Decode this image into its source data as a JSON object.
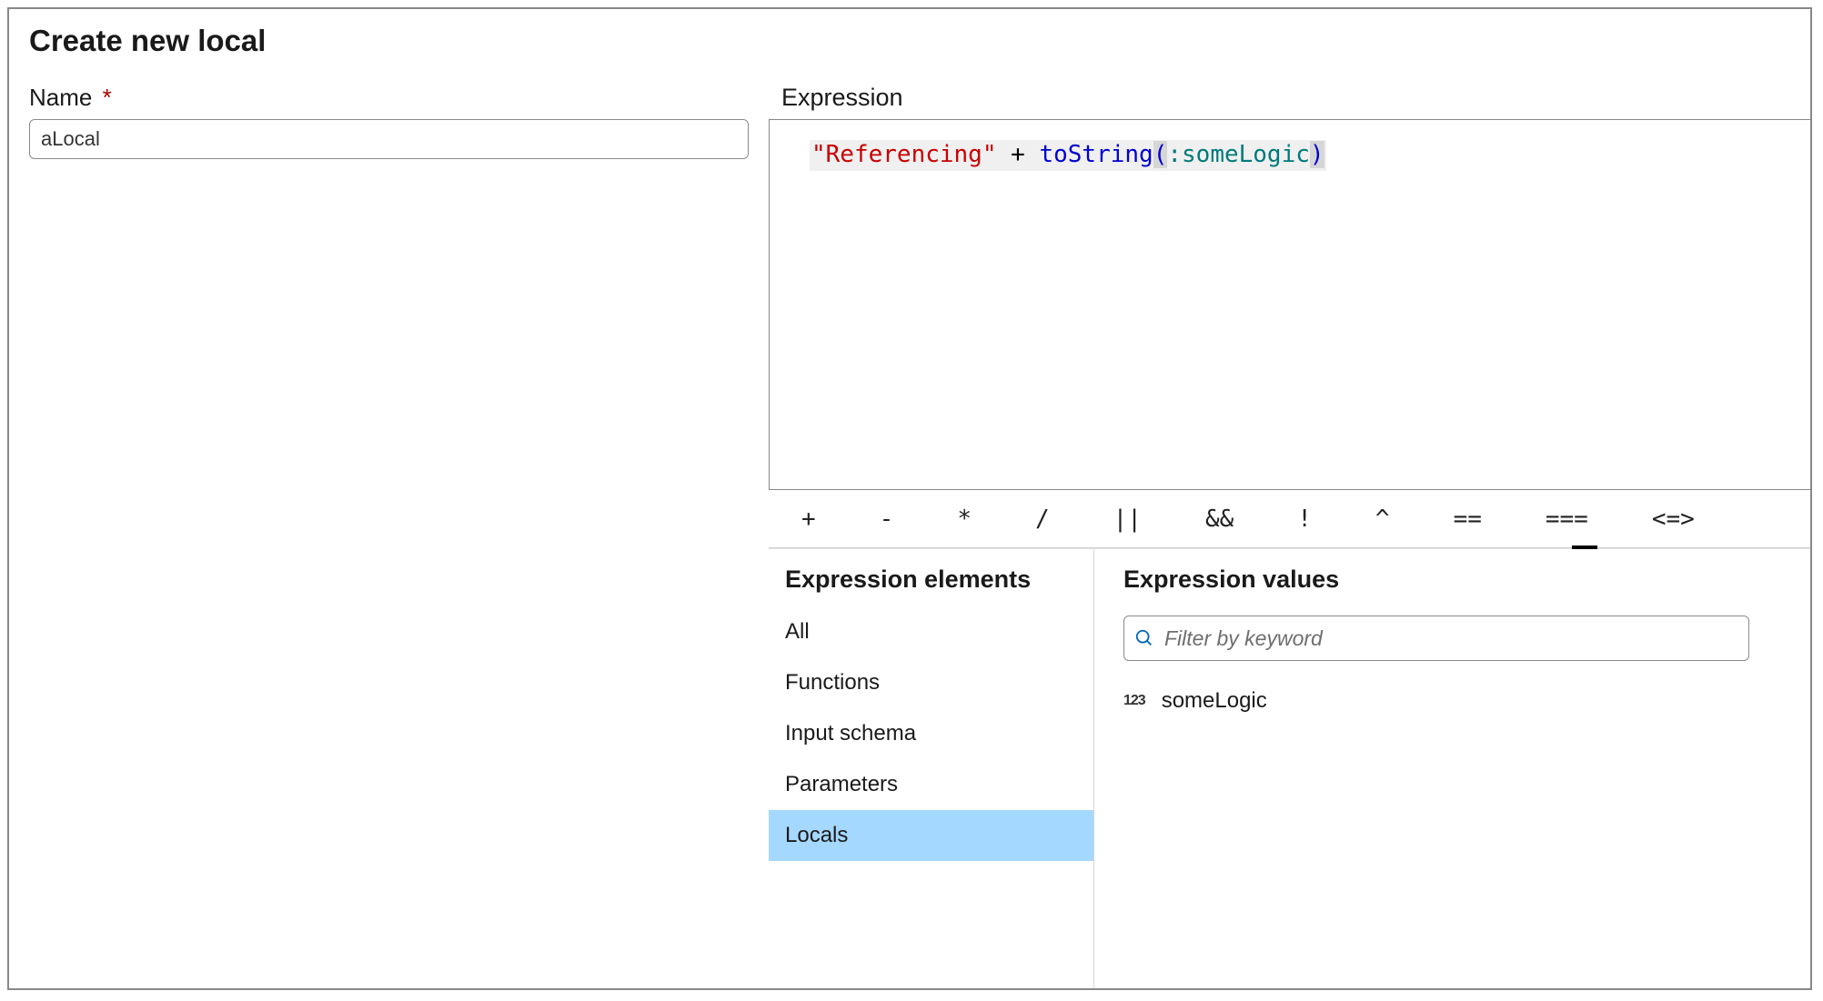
{
  "header": {
    "title": "Create new local"
  },
  "form": {
    "name_label": "Name",
    "required_marker": "*",
    "name_value": "aLocal"
  },
  "expression": {
    "label": "Expression",
    "tokens": {
      "string": "\"Referencing\"",
      "space1": " ",
      "plus": "+",
      "space2": " ",
      "fn": "toString",
      "open": "(",
      "colon": ":",
      "ident": "someLogic",
      "close": ")"
    },
    "raw": "\"Referencing\" + toString(:someLogic)"
  },
  "operators": {
    "items": [
      "+",
      "-",
      "*",
      "/",
      "||",
      "&&",
      "!",
      "^",
      "==",
      "===",
      "<=>"
    ]
  },
  "elements": {
    "title": "Expression elements",
    "items": [
      "All",
      "Functions",
      "Input schema",
      "Parameters",
      "Locals"
    ],
    "selected_index": 4
  },
  "values": {
    "title": "Expression values",
    "filter_placeholder": "Filter by keyword",
    "items": [
      {
        "type_icon": "123",
        "name": "someLogic"
      }
    ]
  }
}
